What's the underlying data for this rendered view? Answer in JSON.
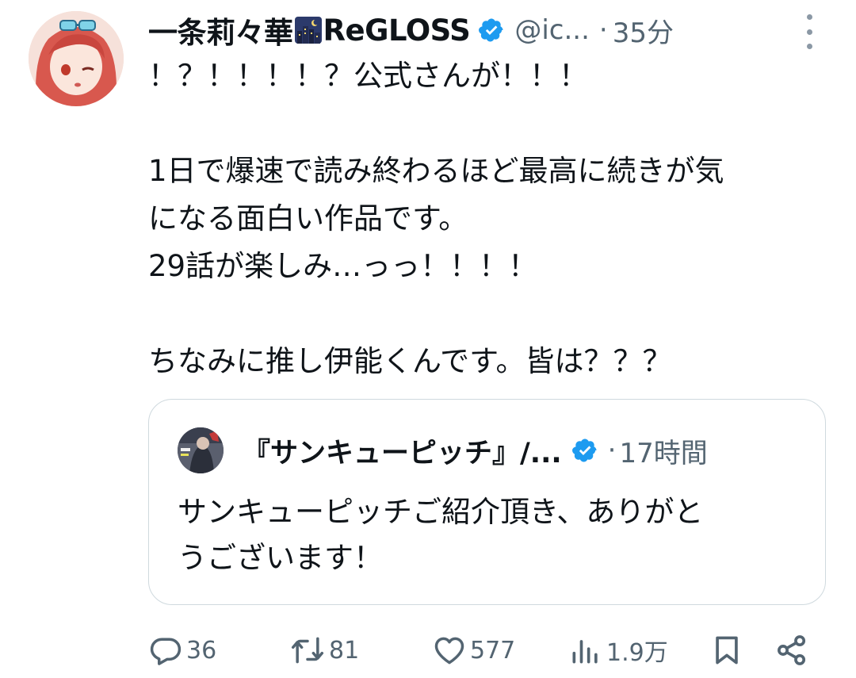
{
  "tweet": {
    "author": {
      "display_name": "一条莉々華",
      "name_suffix": "ReGLOSS",
      "emoji": "night-city-emoji",
      "handle": "@ic...",
      "verified": true
    },
    "separator": "·",
    "time": "35分",
    "text": [
      "！？！！！！？公式さんが！！！",
      "",
      "1日で爆速で読み終わるほど最高に続きが気",
      "になる面白い作品です。",
      "29話が楽しみ…っっ！！！！",
      "",
      "ちなみに推し伊能くんです。皆は？？？"
    ]
  },
  "quote": {
    "display_name": "『サンキューピッチ』/...",
    "verified": true,
    "separator": "·",
    "time": "17時間",
    "text": [
      "サンキューピッチご紹介頂き、ありがと",
      "うございます！"
    ]
  },
  "actions": {
    "reply_count": "36",
    "retweet_count": "81",
    "like_count": "577",
    "view_count": "1.9万"
  },
  "colors": {
    "text": "#0f1419",
    "secondary": "#536471",
    "verified": "#1d9bf0",
    "border": "#cfd9de"
  }
}
